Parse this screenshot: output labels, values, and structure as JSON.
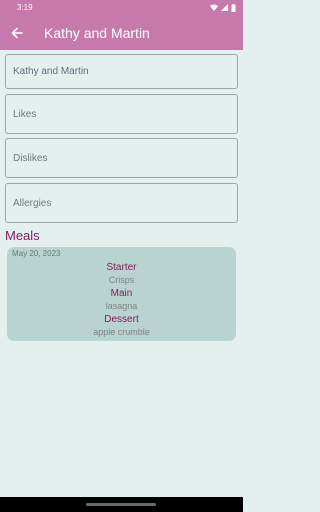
{
  "status_bar": {
    "time": "3:19"
  },
  "app_bar": {
    "title": "Kathy and Martin",
    "back_icon": "arrow-left-icon"
  },
  "form": {
    "name_value": "Kathy and Martin",
    "likes_placeholder": "Likes",
    "dislikes_placeholder": "Dislikes",
    "allergies_placeholder": "Allergies"
  },
  "meals": {
    "heading": "Meals",
    "items": [
      {
        "date": "May 20, 2023",
        "starter_label": "Starter",
        "starter": "Crisps",
        "main_label": "Main",
        "main": "lasagna",
        "dessert_label": "Dessert",
        "dessert": "apple crumble"
      }
    ]
  },
  "colors": {
    "primary": "#c67aab",
    "background": "#e4f0ee",
    "card": "#b8d3d0",
    "accent_text": "#8a1a5e"
  }
}
